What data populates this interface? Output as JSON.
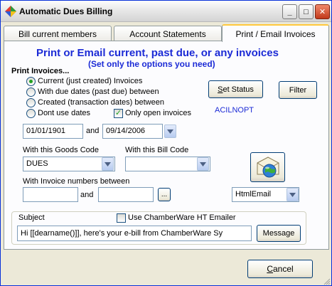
{
  "window": {
    "title": "Automatic Dues Billing"
  },
  "titlebar_buttons": {
    "minimize": "_",
    "maximize": "□",
    "close": "✕"
  },
  "tabs": [
    {
      "label": "Bill current members"
    },
    {
      "label": "Account Statements"
    },
    {
      "label": "Print / Email Invoices"
    }
  ],
  "main": {
    "heading": "Print or Email current, past due, or any invoices",
    "subheading": "(Set only the options you need)",
    "print_invoices_label": "Print Invoices...",
    "radios": [
      {
        "label": "Current (just created) Invoices",
        "selected": true
      },
      {
        "label": "With due dates (past due) between",
        "selected": false
      },
      {
        "label": "Created (transaction dates) between",
        "selected": false
      },
      {
        "label": "Dont use dates",
        "selected": false
      }
    ],
    "only_open_checkbox": {
      "label": "Only open invoices",
      "checked": true
    },
    "set_status_button": "Set Status",
    "set_status_mnemonic": "S",
    "set_status_rest": "et Status",
    "filter_button": "Filter",
    "status_code": "ACILNOPT",
    "date_from": "01/01/1901",
    "date_and": "and",
    "date_to": "09/14/2006",
    "goods_code_label": "With this Goods Code",
    "goods_code_value": "DUES",
    "bill_code_label": "With this Bill Code",
    "bill_code_value": "",
    "invoice_numbers_label": "With Invoice numbers between",
    "invoice_from": "",
    "invoice_and": "and",
    "invoice_to": "",
    "browse_button": "...",
    "send_method_value": "HtmlEmail",
    "subject_group_label": "Subject",
    "chamberware_checkbox": {
      "label": "Use ChamberWare HT Emailer",
      "checked": false
    },
    "subject_value": "Hi [[dearname()]],  here's your e-bill from ChamberWare Sy",
    "message_button": "Message"
  },
  "footer": {
    "cancel_button": "Cancel",
    "cancel_mnemonic": "C",
    "cancel_rest": "ancel"
  },
  "colors": {
    "accent_blue": "#1c2bd6",
    "tab_highlight": "#ffc83c",
    "window_face": "#ece9d8"
  }
}
